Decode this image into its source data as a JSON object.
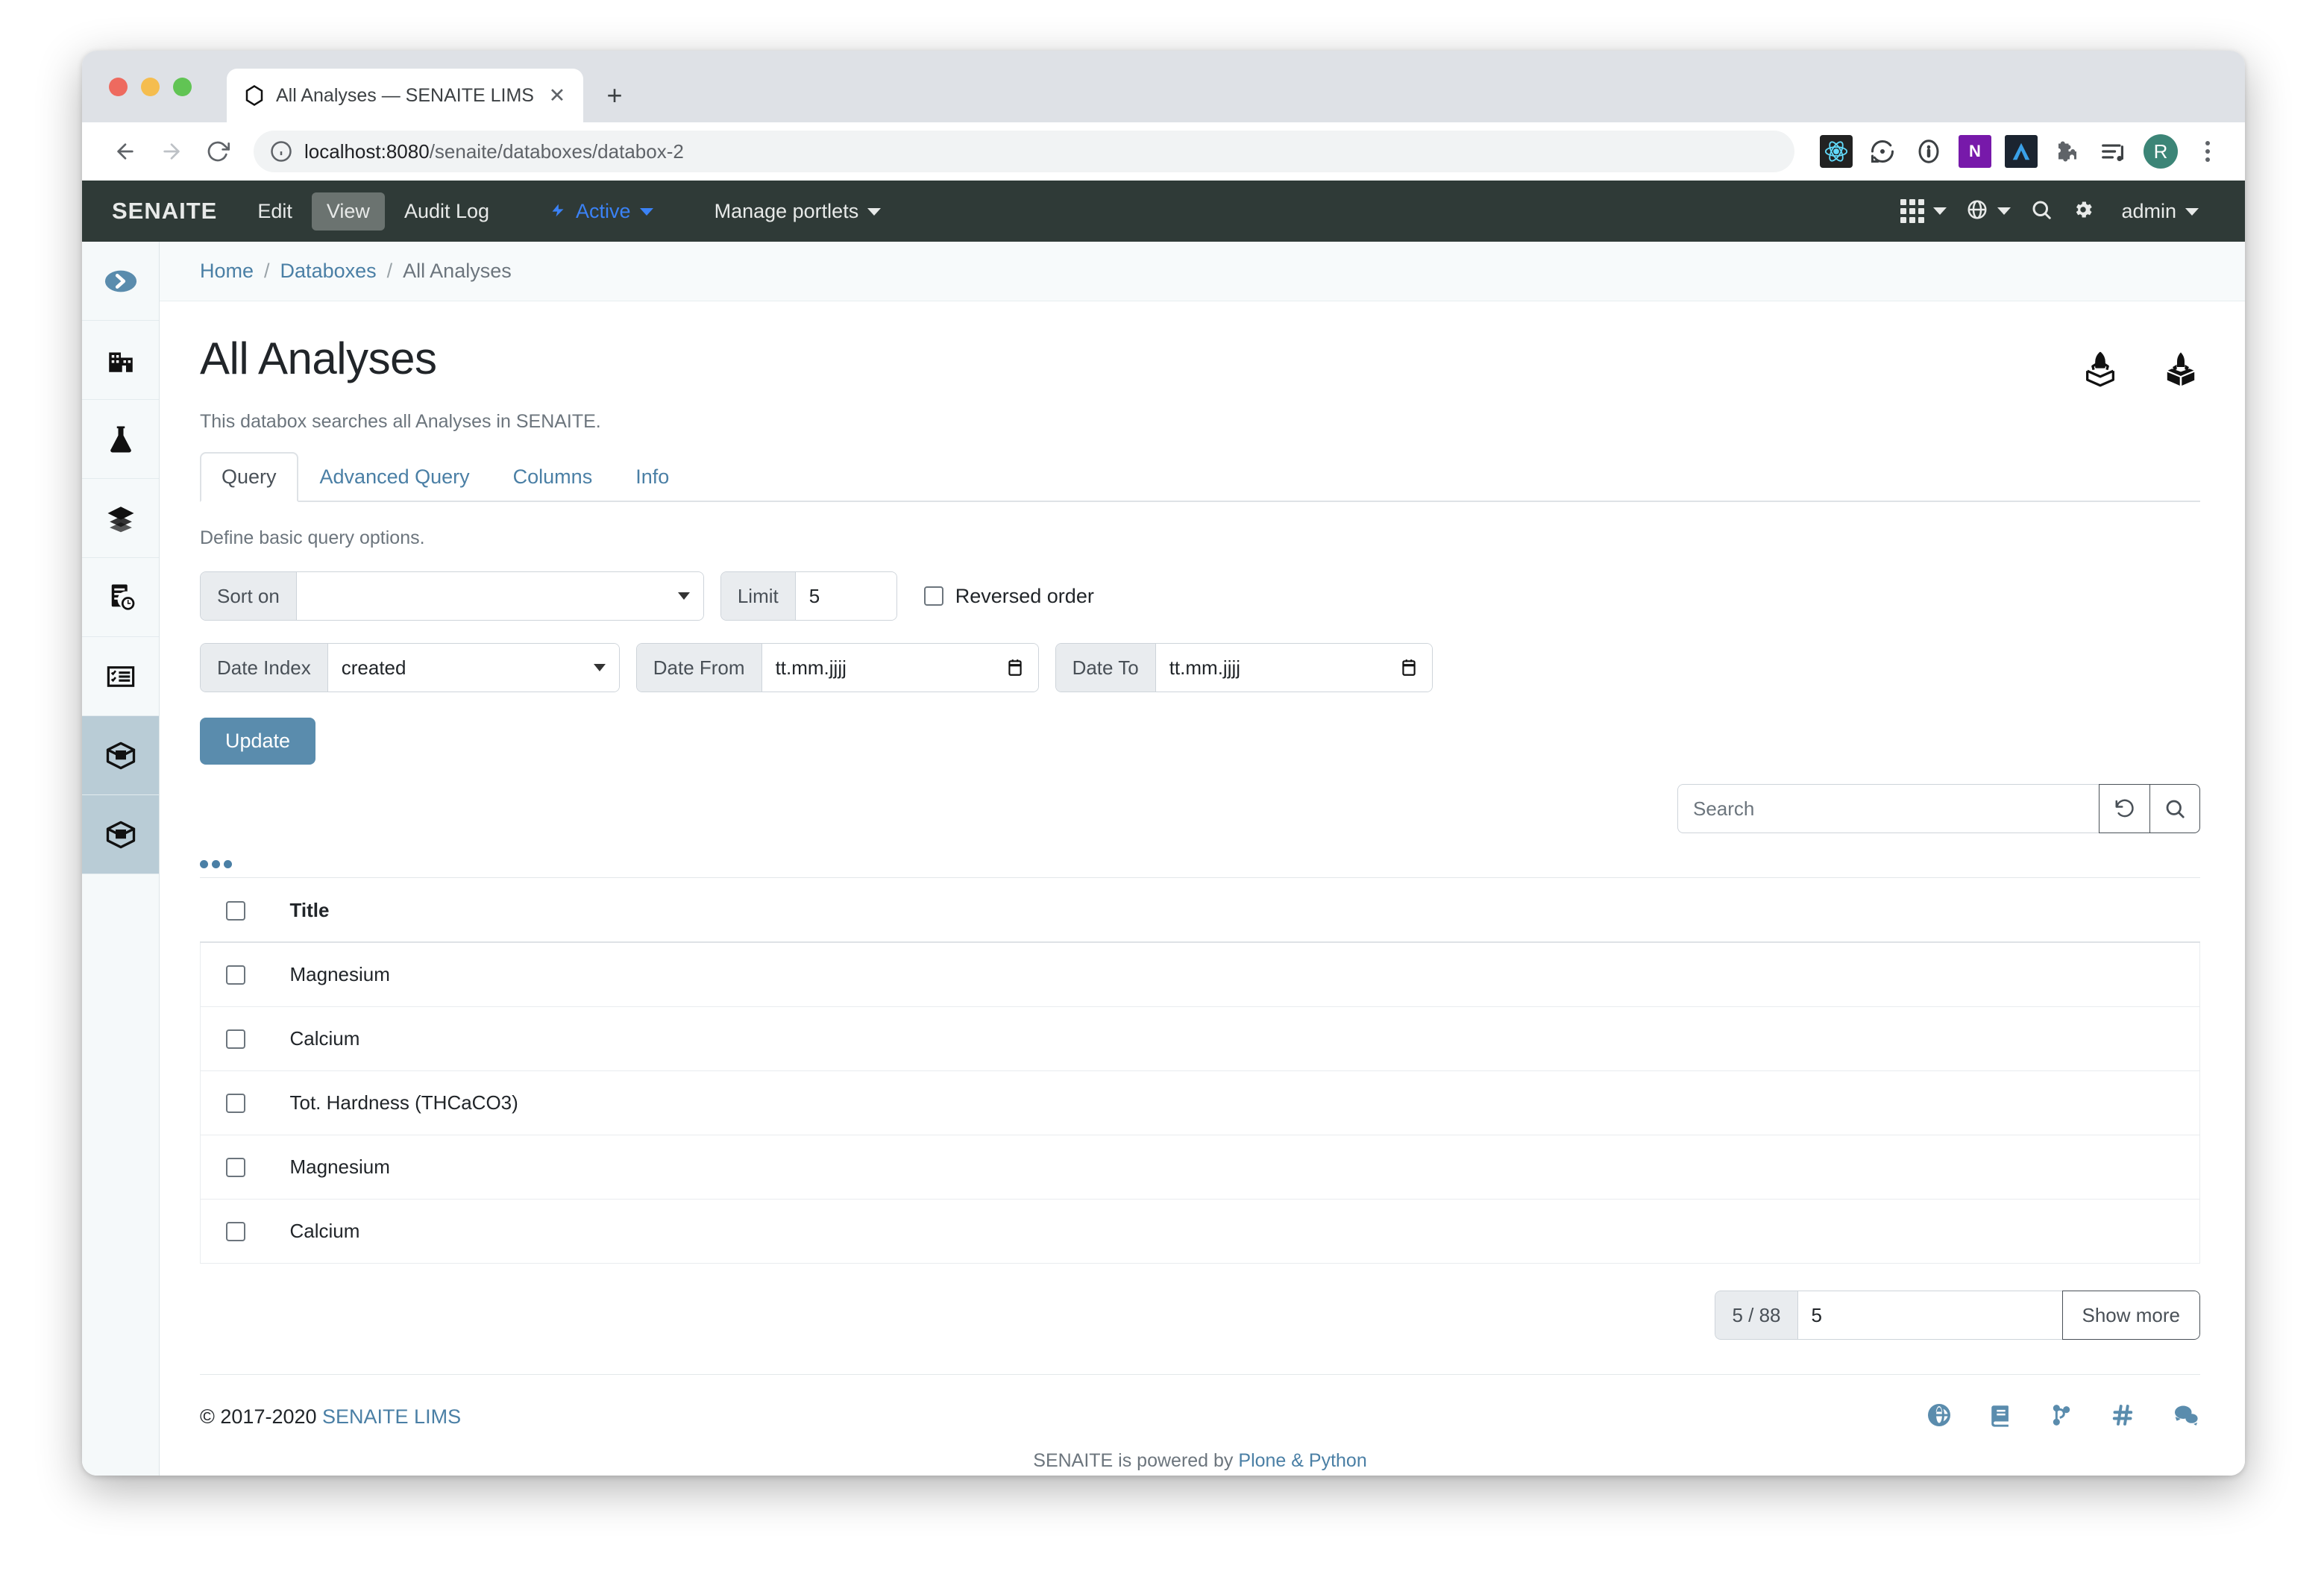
{
  "browser": {
    "tab_title": "All Analyses — SENAITE LIMS",
    "new_tab_label": "+",
    "close_label": "✕",
    "url_host": "localhost:8080",
    "url_path": "/senaite/databoxes/databox-2",
    "profile_initial": "R",
    "onenote_letter": "N"
  },
  "navbar": {
    "brand": "SENAITE",
    "items": [
      {
        "label": "Edit",
        "active": false
      },
      {
        "label": "View",
        "active": true
      },
      {
        "label": "Audit Log",
        "active": false
      }
    ],
    "status_label": "Active",
    "portlets_label": "Manage portlets",
    "user_label": "admin"
  },
  "sidebar": {
    "items": [
      {
        "name": "toggle-sidebar",
        "selected": false
      },
      {
        "name": "clients",
        "selected": false
      },
      {
        "name": "samples",
        "selected": false
      },
      {
        "name": "batches",
        "selected": false
      },
      {
        "name": "worksheets",
        "selected": false
      },
      {
        "name": "tasks",
        "selected": false
      },
      {
        "name": "databoxes",
        "selected": true
      },
      {
        "name": "databox-current",
        "selected": true
      }
    ]
  },
  "breadcrumb": {
    "home": "Home",
    "databoxes": "Databoxes",
    "current": "All Analyses",
    "separator": "/"
  },
  "page": {
    "title": "All Analyses",
    "description": "This databox searches all Analyses in SENAITE."
  },
  "tabs": [
    {
      "label": "Query",
      "active": true
    },
    {
      "label": "Advanced Query",
      "active": false
    },
    {
      "label": "Columns",
      "active": false
    },
    {
      "label": "Info",
      "active": false
    }
  ],
  "query": {
    "hint": "Define basic query options.",
    "sort_on_label": "Sort on",
    "sort_on_value": "",
    "limit_label": "Limit",
    "limit_value": "5",
    "reversed_label": "Reversed order",
    "reversed_checked": false,
    "date_index_label": "Date Index",
    "date_index_value": "created",
    "date_from_label": "Date From",
    "date_from_placeholder": "tt.mm.jjjj",
    "date_to_label": "Date To",
    "date_to_placeholder": "tt.mm.jjjj",
    "update_label": "Update"
  },
  "search": {
    "placeholder": "Search",
    "value": ""
  },
  "table": {
    "columns": [
      "Title"
    ],
    "rows": [
      {
        "title": "Magnesium"
      },
      {
        "title": "Calcium"
      },
      {
        "title": "Tot. Hardness (THCaCO3)"
      },
      {
        "title": "Magnesium"
      },
      {
        "title": "Calcium"
      }
    ]
  },
  "pagination": {
    "count_label": "5 / 88",
    "input_value": "5",
    "show_more_label": "Show more"
  },
  "footer": {
    "copyright": "© 2017-2020",
    "brand_link": "SENAITE LIMS",
    "powered_prefix": "SENAITE is powered by ",
    "powered_link": "Plone & Python"
  },
  "colors": {
    "navbar_bg": "#2f3a37",
    "accent": "#5a8cad",
    "link": "#4a7fa5",
    "sidebar_bg": "#f5f9fa",
    "sidebar_selected": "#b9ccd6",
    "active_blue": "#3b82f6"
  }
}
